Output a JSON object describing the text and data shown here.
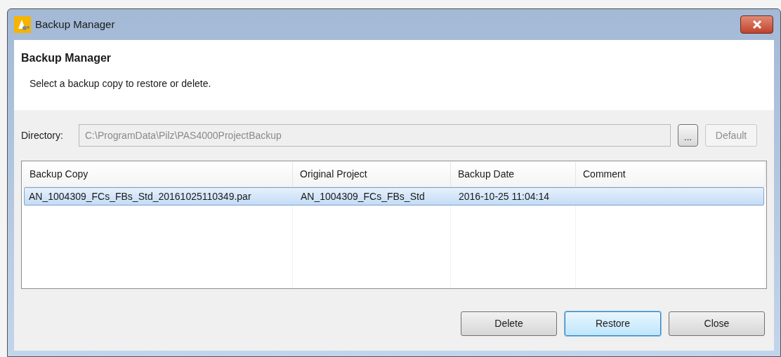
{
  "window": {
    "title": "Backup Manager"
  },
  "header": {
    "title": "Backup Manager",
    "description": "Select a backup copy to restore or delete."
  },
  "directory": {
    "label": "Directory:",
    "value": "C:\\ProgramData\\Pilz\\PAS4000ProjectBackup",
    "disabled": true,
    "browse_button": "...",
    "default_button": {
      "label": "Default",
      "disabled": true
    }
  },
  "table": {
    "columns": [
      "Backup Copy",
      "Original Project",
      "Backup Date",
      "Comment"
    ],
    "rows": [
      {
        "cells": [
          "AN_1004309_FCs_FBs_Std_20161025110349.par",
          "AN_1004309_FCs_FBs_Std",
          "2016-10-25 11:04:14",
          ""
        ],
        "selected": true
      }
    ]
  },
  "buttons": [
    {
      "label": "Delete",
      "default": false
    },
    {
      "label": "Restore",
      "default": true
    },
    {
      "label": "Close",
      "default": false
    }
  ]
}
